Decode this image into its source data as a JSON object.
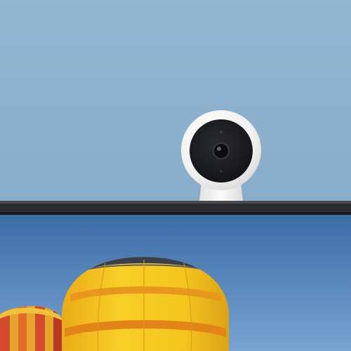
{
  "scene": {
    "subject": "camera-on-monitor",
    "colors": {
      "wall": "#8fb3cf",
      "wall_shade": "#86abc8",
      "camera_body": "#f4f4f2",
      "camera_face": "#1c1d20",
      "monitor_bezel": "#2a2a2c",
      "sky_top": "#3e6fa8",
      "sky_bottom": "#6f9ccc",
      "balloon_yellow": "#f2c41b",
      "balloon_orange": "#e8891f",
      "balloon_red": "#d6452a"
    }
  }
}
